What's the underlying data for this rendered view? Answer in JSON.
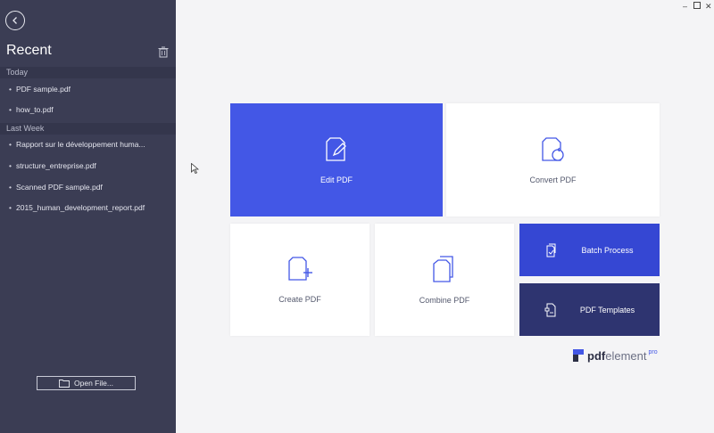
{
  "sidebar": {
    "title": "Recent",
    "sections": [
      {
        "label": "Today",
        "files": [
          "PDF sample.pdf",
          "how_to.pdf"
        ]
      },
      {
        "label": "Last Week",
        "files": [
          "Rapport sur le développement huma...",
          "structure_entreprise.pdf",
          "Scanned PDF sample.pdf",
          "2015_human_development_report.pdf"
        ]
      }
    ],
    "open_file_label": "Open File..."
  },
  "tiles": {
    "edit": "Edit PDF",
    "convert": "Convert PDF",
    "create": "Create PDF",
    "combine": "Combine PDF",
    "batch": "Batch Process",
    "templates": "PDF Templates"
  },
  "logo": {
    "pdf": "pdf",
    "element": "element",
    "pro": "pro"
  },
  "colors": {
    "sidebar_bg": "#3b3d54",
    "edit_tile": "#4357e6",
    "batch_tile": "#3547d3",
    "templates_tile": "#2e3470"
  }
}
